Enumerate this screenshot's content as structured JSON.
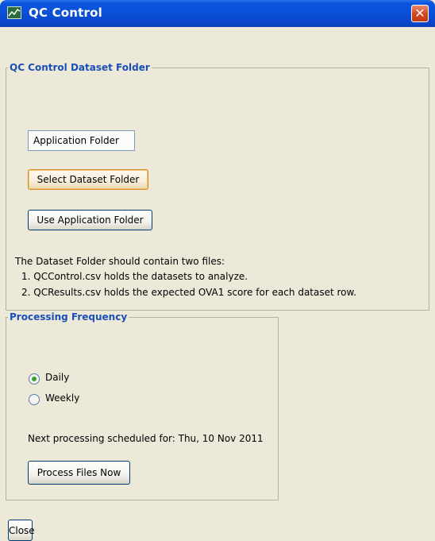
{
  "window": {
    "title": "QC Control",
    "close_glyph": "✕"
  },
  "dataset_group": {
    "legend": "QC Control Dataset Folder",
    "current_folder": "Application Folder",
    "select_button": "Select Dataset Folder",
    "use_app_button": "Use Application Folder",
    "info_line1": "The Dataset Folder should contain two files:",
    "info_line2": "1. QCControl.csv holds the datasets to analyze.",
    "info_line3": "2. QCResults.csv holds the expected OVA1 score for each dataset row."
  },
  "frequency_group": {
    "legend": "Processing Frequency",
    "option_daily": "Daily",
    "option_weekly": "Weekly",
    "selected": "Daily",
    "next_processing": "Next processing scheduled for: Thu, 10 Nov 2011",
    "process_button": "Process Files Now"
  },
  "footer": {
    "close_button": "Close"
  },
  "icons": {
    "app": "chart-app-icon",
    "close": "close-icon",
    "radio": "radio-icon"
  }
}
